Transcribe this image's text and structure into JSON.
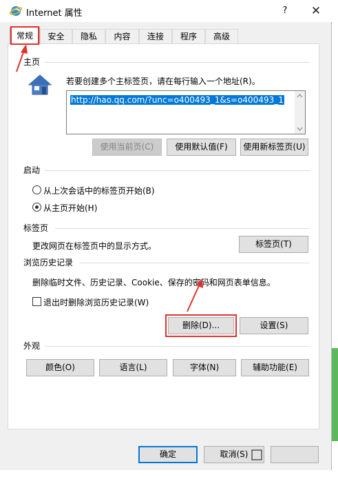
{
  "window": {
    "title": "Internet 属性",
    "help_label": "?",
    "close_label": "✕"
  },
  "tabs": [
    {
      "label": "常规",
      "active": true
    },
    {
      "label": "安全"
    },
    {
      "label": "隐私"
    },
    {
      "label": "内容"
    },
    {
      "label": "连接"
    },
    {
      "label": "程序"
    },
    {
      "label": "高级"
    }
  ],
  "home": {
    "section_title": "主页",
    "instruction": "若要创建多个主标签页，请在每行输入一个地址(R)。",
    "url_value": "http://hao.qq.com/?unc=o400493_1&s=o400493_1",
    "buttons": {
      "use_current": "使用当前页(C)",
      "use_default": "使用默认值(F)",
      "use_new_tab": "使用新标签页(U)"
    }
  },
  "startup": {
    "section_title": "启动",
    "option_last_session": "从上次会话中的标签页开始(B)",
    "option_home_page": "从主页开始(H)",
    "selected": "home_page"
  },
  "tabs_section": {
    "section_title": "标签页",
    "description": "更改网页在标签页中的显示方式。",
    "button_label": "标签页(T)"
  },
  "history": {
    "section_title": "浏览历史记录",
    "description": "删除临时文件、历史记录、Cookie、保存的密码和网页表单信息。",
    "checkbox_label": "退出时删除浏览历史记录(W)",
    "checked": false,
    "delete_label": "删除(D)...",
    "settings_label": "设置(S)"
  },
  "appearance": {
    "section_title": "外观",
    "colors": "颜色(O)",
    "languages": "语言(L)",
    "fonts": "字体(N)",
    "accessibility": "辅助功能(E)"
  },
  "dialog_buttons": {
    "ok": "确定",
    "cancel": "取消(S)"
  },
  "colors": {
    "accent": "#0078d7",
    "annotation": "#e0322d"
  },
  "icons": {
    "title": "ie-globe-icon",
    "home": "house-icon"
  }
}
